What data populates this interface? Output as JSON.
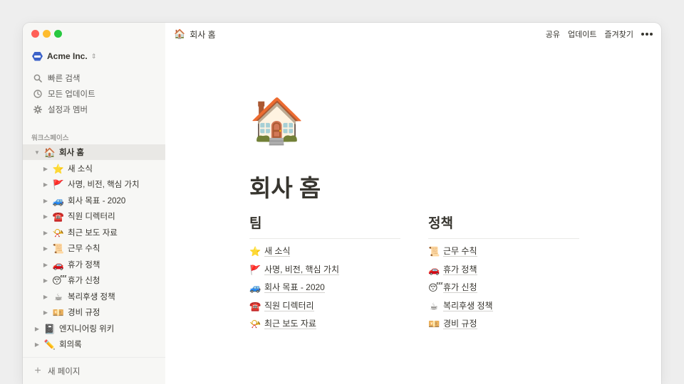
{
  "workspace": {
    "name": "Acme Inc."
  },
  "sidebar": {
    "quick": [
      {
        "label": "빠른 검색",
        "icon": "search-icon"
      },
      {
        "label": "모든 업데이트",
        "icon": "clock-icon"
      },
      {
        "label": "설정과 멤버",
        "icon": "gear-icon"
      }
    ],
    "section_label": "워크스페이스",
    "tree": [
      {
        "emoji": "🏠",
        "label": "회사 홈",
        "caret": "▼",
        "active": true
      },
      {
        "emoji": "⭐",
        "label": "새 소식",
        "caret": "▶"
      },
      {
        "emoji": "🚩",
        "label": "사명, 비전, 핵심 가치",
        "caret": "▶"
      },
      {
        "emoji": "🚙",
        "label": "회사 목표 - 2020",
        "caret": "▶"
      },
      {
        "emoji": "☎️",
        "label": "직원 디렉터리",
        "caret": "▶"
      },
      {
        "emoji": "📯",
        "label": "최근 보도 자료",
        "caret": "▶"
      },
      {
        "emoji": "📜",
        "label": "근무 수칙",
        "caret": "▶"
      },
      {
        "emoji": "🚗",
        "label": "휴가 정책",
        "caret": "▶"
      },
      {
        "emoji": "😴",
        "label": "휴가 신청",
        "caret": "▶"
      },
      {
        "emoji": "☕",
        "label": "복리후생 정책",
        "caret": "▶"
      },
      {
        "emoji": "💴",
        "label": "경비 규정",
        "caret": "▶"
      },
      {
        "emoji": "📓",
        "label": "엔지니어링 위키",
        "caret": "▶"
      },
      {
        "emoji": "✏️",
        "label": "회의록",
        "caret": "▶"
      }
    ],
    "new_page": "새 페이지"
  },
  "topbar": {
    "breadcrumb": {
      "emoji": "🏠",
      "label": "회사 홈"
    },
    "share": "공유",
    "updates": "업데이트",
    "favorites": "즐겨찾기"
  },
  "page": {
    "icon": "🏠",
    "title": "회사 홈",
    "columns": [
      {
        "heading": "팀",
        "links": [
          {
            "emoji": "⭐",
            "label": "새 소식"
          },
          {
            "emoji": "🚩",
            "label": "사명, 비전, 핵심 가치"
          },
          {
            "emoji": "🚙",
            "label": "회사 목표 - 2020"
          },
          {
            "emoji": "☎️",
            "label": "직원 디렉터리"
          },
          {
            "emoji": "📯",
            "label": "최근 보도 자료"
          }
        ]
      },
      {
        "heading": "정책",
        "links": [
          {
            "emoji": "📜",
            "label": "근무 수칙"
          },
          {
            "emoji": "🚗",
            "label": "휴가 정책"
          },
          {
            "emoji": "😴",
            "label": "휴가 신청"
          },
          {
            "emoji": "☕",
            "label": "복리후생 정책"
          },
          {
            "emoji": "💴",
            "label": "경비 규정"
          }
        ]
      }
    ]
  }
}
